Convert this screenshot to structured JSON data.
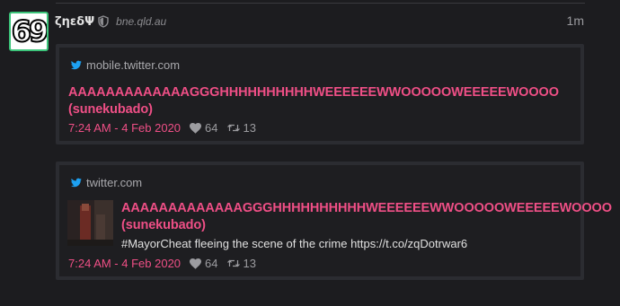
{
  "post": {
    "username": "ζηεδΨ",
    "avatar_text": "69",
    "location": "bne.qld.au",
    "timestamp": "1m"
  },
  "oneboxes": [
    {
      "source": "mobile.twitter.com",
      "title": "AAAAAAAAAAAAAGGGHHHHHHHHHHWEEEEEEWWOOOOOWEEEEEWOOOO (sunekubado)",
      "date": "7:24 AM - 4 Feb 2020",
      "likes": "64",
      "retweets": "13"
    },
    {
      "source": "twitter.com",
      "title": "AAAAAAAAAAAAAGGGHHHHHHHHHHWEEEEEEWWOOOOOWEEEEEWOOOO (sunekubado)",
      "text": "#MayorCheat fleeing the scene of the crime https://t.co/zqDotrwar6",
      "date": "7:24 AM - 4 Feb 2020",
      "likes": "64",
      "retweets": "13"
    }
  ],
  "colors": {
    "accent": "#ef4f86",
    "twitter_blue": "#1da1f2",
    "avatar_border": "#3cc47a",
    "background": "#1c1c1f"
  },
  "icons": {
    "shield": "shield-icon",
    "source": "twitter-bird-icon",
    "likes": "heart-icon",
    "retweets": "retweet-icon"
  }
}
